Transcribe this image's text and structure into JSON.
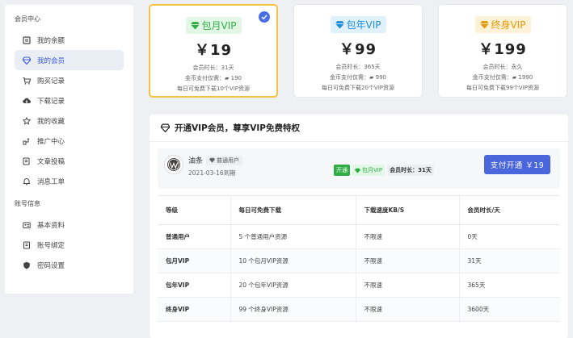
{
  "sidebar": {
    "group1": "会员中心",
    "group1_items": [
      {
        "label": "我的余额",
        "icon": "wallet-icon"
      },
      {
        "label": "我的会员",
        "icon": "diamond-icon",
        "active": true
      },
      {
        "label": "购买记录",
        "icon": "cart-icon"
      },
      {
        "label": "下载记录",
        "icon": "cloud-download-icon"
      },
      {
        "label": "我的收藏",
        "icon": "star-icon"
      },
      {
        "label": "推广中心",
        "icon": "share-icon"
      },
      {
        "label": "文章投稿",
        "icon": "edit-icon"
      },
      {
        "label": "消息工单",
        "icon": "bell-icon"
      }
    ],
    "group2": "账号信息",
    "group2_items": [
      {
        "label": "基本资料",
        "icon": "id-card-icon"
      },
      {
        "label": "账号绑定",
        "icon": "link-icon"
      },
      {
        "label": "密码设置",
        "icon": "shield-icon"
      }
    ]
  },
  "plans": [
    {
      "name": "包月VIP",
      "price": "￥19",
      "duration": "会员时长：31天",
      "coins": "金币支付仅需：",
      "coin_amount": "190",
      "quota": "每日可免费下载10个VIP资源",
      "selected": true,
      "color": "#2fae45"
    },
    {
      "name": "包年VIP",
      "price": "￥99",
      "duration": "会员时长：365天",
      "coins": "金币支付仅需：",
      "coin_amount": "990",
      "quota": "每日可免费下载20个VIP资源",
      "selected": false,
      "color": "#1d8fd6"
    },
    {
      "name": "终身VIP",
      "price": "￥199",
      "duration": "会员时长：永久",
      "coins": "金币支付仅需：",
      "coin_amount": "1990",
      "quota": "每日可免费下载99个VIP资源",
      "selected": false,
      "color": "#e59a0a"
    }
  ],
  "panel": {
    "title": "开通VIP会员，尊享VIP免费特权",
    "user": {
      "name": "油条",
      "tag": "普通用户",
      "expiry": "2021-03-16到期"
    },
    "tags": {
      "open": "开通",
      "plan": "包月VIP",
      "duration": "会员时长：31天"
    },
    "pay_button": "支付开通 ￥19"
  },
  "table": {
    "headers": [
      "等级",
      "每日可免费下载",
      "下载速度KB/S",
      "会员时长/天"
    ],
    "rows": [
      [
        "普通用户",
        "5 个普通用户资源",
        "不限速",
        "0天"
      ],
      [
        "包月VIP",
        "10 个包月VIP资源",
        "不限速",
        "31天"
      ],
      [
        "包年VIP",
        "20 个包年VIP资源",
        "不限速",
        "365天"
      ],
      [
        "终身VIP",
        "99 个终身VIP资源",
        "不限速",
        "3600天"
      ]
    ]
  }
}
